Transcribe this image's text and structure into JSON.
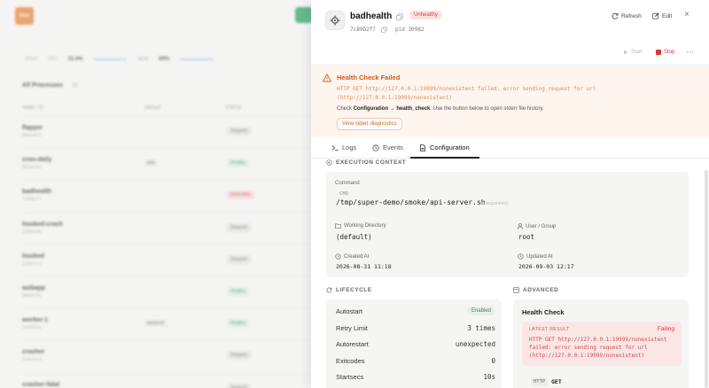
{
  "background": {
    "logo_text": "Sttze",
    "stats": [
      {
        "label": "HOST",
        "value": ""
      },
      {
        "label": "CPU",
        "value": "15.4%"
      },
      {
        "label": "MEM",
        "value": "69%"
      }
    ],
    "list_title": "All Processes",
    "list_count": "11",
    "columns": [
      "NAME / ID",
      "GROUP",
      "STATUS"
    ],
    "rows": [
      {
        "name": "flapper",
        "id": "68da3473",
        "group": "",
        "status": "Stopped",
        "kind": "stopped"
      },
      {
        "name": "cron-daily",
        "id": "9024b793",
        "group": "jobs",
        "status": "Healthy",
        "kind": "healthy"
      },
      {
        "name": "badhealth",
        "id": "7c89b2f7",
        "group": "",
        "status": "Unhealthy",
        "kind": "unhealthy"
      },
      {
        "name": "hooked-crash",
        "id": "b2904e48",
        "group": "",
        "status": "Stopped",
        "kind": "stopped"
      },
      {
        "name": "hooked",
        "id": "a28da513",
        "group": "",
        "status": "Stopped",
        "kind": "stopped"
      },
      {
        "name": "webapp",
        "id": "9084b256",
        "group": "",
        "status": "Healthy",
        "kind": "healthy"
      },
      {
        "name": "worker-1",
        "id": "1839553e",
        "group": "backend",
        "status": "Healthy",
        "kind": "healthy"
      },
      {
        "name": "crasher",
        "id": "3c9e32a3",
        "group": "",
        "status": "Stopped",
        "kind": "stopped"
      },
      {
        "name": "crasher-fatal",
        "id": "4d2a8f1c",
        "group": "",
        "status": "Stopped",
        "kind": "stopped"
      }
    ]
  },
  "panel": {
    "name": "badhealth",
    "status": "Unhealthy",
    "id": "7c89b2f7",
    "pid": "pid 30982",
    "refresh_label": "Refresh",
    "edit_label": "Edit",
    "close_label": "×",
    "start_label": "Start",
    "stop_label": "Stop",
    "more_label": "···"
  },
  "alert": {
    "title": "Health Check Failed",
    "message": "HTTP GET http://127.0.0.1:19999/nonexistent failed: error sending request for url (http://127.0.0.1:19999/nonexistent)",
    "hint_prefix": "Check",
    "hint_bold": "Configuration → health_check",
    "hint_suffix": ". Use the button below to open stderr file history.",
    "button_label": "View stderr diagnostics"
  },
  "tabs": [
    {
      "label": "Logs"
    },
    {
      "label": "Events"
    },
    {
      "label": "Configuration"
    }
  ],
  "execution": {
    "section_title": "EXECUTION CONTEXT",
    "command_label": "Command",
    "cmd_tag": "CMD",
    "command": "/tmp/super-demo/smoke/api-server.sh",
    "no_args": "(no arguments)",
    "workdir_label": "Working Directory",
    "workdir": "(default)",
    "user_label": "User / Group",
    "user": "root",
    "created_label": "Created At",
    "created": "2026-08-31 11:18",
    "updated_label": "Updated At",
    "updated": "2026-09-03 12:17"
  },
  "lifecycle": {
    "section_title": "LIFECYCLE",
    "rows": [
      {
        "label": "Autostart",
        "value": "Enabled"
      },
      {
        "label": "Retry Limit",
        "value": "3 times"
      },
      {
        "label": "Autorestart",
        "value": "unexpected"
      },
      {
        "label": "Exitcodes",
        "value": "0"
      },
      {
        "label": "Startsecs",
        "value": "10s"
      }
    ]
  },
  "advanced": {
    "section_title": "ADVANCED",
    "health_title": "Health Check",
    "latest_label": "LATEST RESULT",
    "latest_status": "Failing",
    "latest_message": "HTTP GET http://127.0.0.1:19999/nonexistent failed: error sending request for url (http://127.0.0.1:19999/nonexistent)",
    "method_tag": "HTTP",
    "method": "GET"
  }
}
